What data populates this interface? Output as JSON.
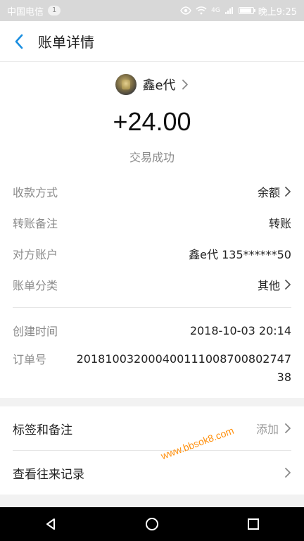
{
  "status_bar": {
    "carrier": "中国电信",
    "notif_count": "1",
    "time": "晚上9:25",
    "signal_text": "4G"
  },
  "header": {
    "title": "账单详情"
  },
  "summary": {
    "merchant": "鑫e代",
    "amount": "+24.00",
    "status": "交易成功"
  },
  "details": [
    {
      "label": "收款方式",
      "value": "余额",
      "has_chevron": true
    },
    {
      "label": "转账备注",
      "value": "转账",
      "has_chevron": false
    },
    {
      "label": "对方账户",
      "value": "鑫e代 135******50",
      "has_chevron": false
    },
    {
      "label": "账单分类",
      "value": "其他",
      "has_chevron": true
    }
  ],
  "timestamps": {
    "created_label": "创建时间",
    "created_value": "2018-10-03 20:14",
    "order_label": "订单号",
    "order_value": "2018100320004001110087008027 47 38"
  },
  "menu": [
    {
      "label": "标签和备注",
      "action": "添加"
    },
    {
      "label": "查看往来记录",
      "action": ""
    }
  ],
  "watermark": "www.bbsok8.com",
  "colors": {
    "accent": "#1a8ee0",
    "watermark": "#ff8a00"
  },
  "icons": [
    "back-icon",
    "chevron-right-icon",
    "wifi-icon",
    "battery-icon",
    "nav-back-icon",
    "nav-home-icon",
    "nav-recent-icon"
  ]
}
